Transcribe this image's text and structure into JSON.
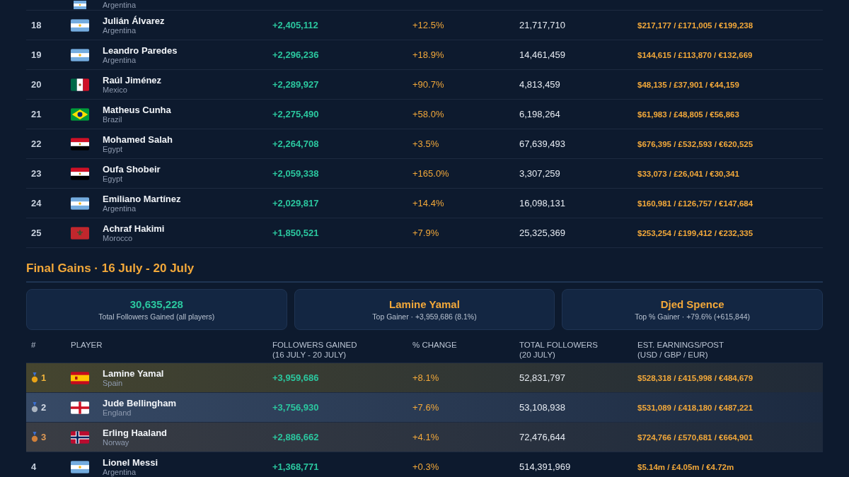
{
  "top_table": {
    "partial_row": {
      "flag": {
        "kind": "ar"
      },
      "country": "Argentina"
    },
    "rows": [
      {
        "rank": "18",
        "flag": {
          "kind": "ar"
        },
        "name": "Julián Álvarez",
        "country": "Argentina",
        "gained": "+2,405,112",
        "change": "+12.5%",
        "total": "21,717,710",
        "earnings": "$217,177 / £171,005 / €199,238"
      },
      {
        "rank": "19",
        "flag": {
          "kind": "ar"
        },
        "name": "Leandro Paredes",
        "country": "Argentina",
        "gained": "+2,296,236",
        "change": "+18.9%",
        "total": "14,461,459",
        "earnings": "$144,615 / £113,870 / €132,669"
      },
      {
        "rank": "20",
        "flag": {
          "kind": "mx"
        },
        "name": "Raúl Jiménez",
        "country": "Mexico",
        "gained": "+2,289,927",
        "change": "+90.7%",
        "total": "4,813,459",
        "earnings": "$48,135 / £37,901 / €44,159"
      },
      {
        "rank": "21",
        "flag": {
          "kind": "br"
        },
        "name": "Matheus Cunha",
        "country": "Brazil",
        "gained": "+2,275,490",
        "change": "+58.0%",
        "total": "6,198,264",
        "earnings": "$61,983 / £48,805 / €56,863"
      },
      {
        "rank": "22",
        "flag": {
          "kind": "eg"
        },
        "name": "Mohamed Salah",
        "country": "Egypt",
        "gained": "+2,264,708",
        "change": "+3.5%",
        "total": "67,639,493",
        "earnings": "$676,395 / £532,593 / €620,525"
      },
      {
        "rank": "23",
        "flag": {
          "kind": "eg"
        },
        "name": "Oufa Shobeir",
        "country": "Egypt",
        "gained": "+2,059,338",
        "change": "+165.0%",
        "total": "3,307,259",
        "earnings": "$33,073 / £26,041 / €30,341"
      },
      {
        "rank": "24",
        "flag": {
          "kind": "ar"
        },
        "name": "Emiliano Martínez",
        "country": "Argentina",
        "gained": "+2,029,817",
        "change": "+14.4%",
        "total": "16,098,131",
        "earnings": "$160,981 / £126,757 / €147,684"
      },
      {
        "rank": "25",
        "flag": {
          "kind": "ma"
        },
        "name": "Achraf Hakimi",
        "country": "Morocco",
        "gained": "+1,850,521",
        "change": "+7.9%",
        "total": "25,325,369",
        "earnings": "$253,254 / £199,412 / €232,335"
      }
    ]
  },
  "final": {
    "title": "Final Gains · 16 July - 20 July",
    "cards": [
      {
        "value": "30,635,228",
        "caption": "Total Followers Gained (all players)",
        "kind": "total"
      },
      {
        "value": "Lamine Yamal",
        "caption": "Top Gainer · +3,959,686 (8.1%)",
        "kind": "player"
      },
      {
        "value": "Djed Spence",
        "caption": "Top % Gainer · +79.6% (+615,844)",
        "kind": "player"
      }
    ],
    "columns": [
      {
        "label": "#"
      },
      {
        "label": "PLAYER"
      },
      {
        "label": "FOLLOWERS GAINED",
        "sub": "(16 JULY - 20 JULY)"
      },
      {
        "label": "% CHANGE"
      },
      {
        "label": "TOTAL FOLLOWERS",
        "sub": "(20 JULY)"
      },
      {
        "label": "EST. EARNINGS/POST",
        "sub": "(USD / GBP / EUR)"
      }
    ],
    "rows": [
      {
        "rank": "1",
        "medal": {
          "kind": "gold"
        },
        "flag": {
          "kind": "es"
        },
        "name": "Lamine Yamal",
        "country": "Spain",
        "gained": "+3,959,686",
        "change": "+8.1%",
        "total": "52,831,797",
        "earnings": "$528,318 / £415,998 / €484,679"
      },
      {
        "rank": "2",
        "medal": {
          "kind": "silver"
        },
        "flag": {
          "kind": "en"
        },
        "name": "Jude Bellingham",
        "country": "England",
        "gained": "+3,756,930",
        "change": "+7.6%",
        "total": "53,108,938",
        "earnings": "$531,089 / £418,180 / €487,221"
      },
      {
        "rank": "3",
        "medal": {
          "kind": "bronze"
        },
        "flag": {
          "kind": "no"
        },
        "name": "Erling Haaland",
        "country": "Norway",
        "gained": "+2,886,662",
        "change": "+4.1%",
        "total": "72,476,644",
        "earnings": "$724,766 / £570,681 / €664,901"
      },
      {
        "rank": "4",
        "flag": {
          "kind": "ar"
        },
        "name": "Lionel Messi",
        "country": "Argentina",
        "gained": "+1,368,771",
        "change": "+0.3%",
        "total": "514,391,969",
        "earnings": "$5.14m / £4.05m / €4.72m"
      }
    ]
  }
}
